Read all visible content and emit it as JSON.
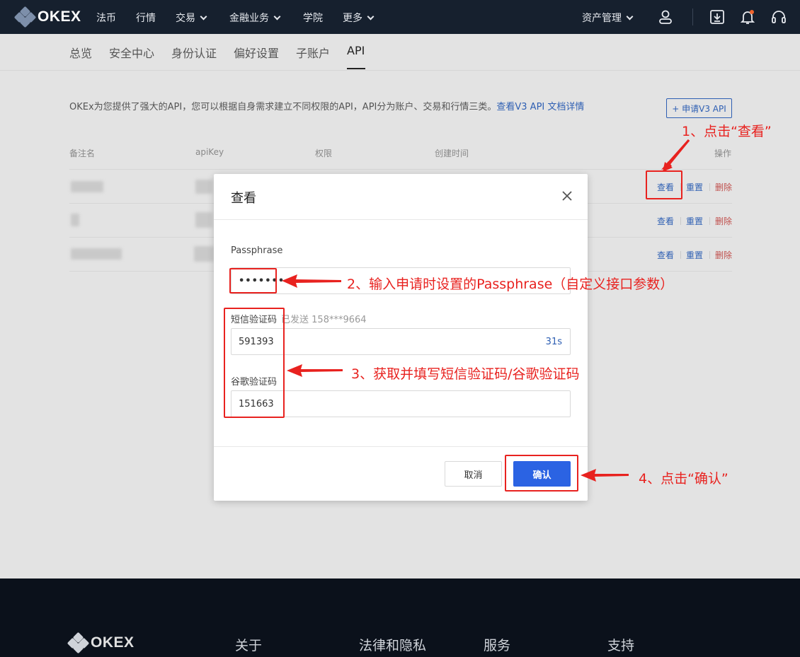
{
  "nav": {
    "logo_text": "OKEX",
    "items": [
      "法币",
      "行情",
      "交易",
      "金融业务",
      "学院",
      "更多"
    ],
    "asset_mgmt": "资产管理"
  },
  "tabs": [
    "总览",
    "安全中心",
    "身份认证",
    "偏好设置",
    "子账户",
    "API"
  ],
  "main": {
    "intro": "OKEx为您提供了强大的API，您可以根据自身需求建立不同权限的API，API分为账户、交易和行情三类。",
    "intro_link": "查看V3 API 文档详情",
    "apply_button": "+ 申请V3 API",
    "table_headers": [
      "备注名",
      "apiKey",
      "权限",
      "创建时间",
      "操作"
    ],
    "row_actions": {
      "view": "查看",
      "reset": "重置",
      "delete": "删除"
    }
  },
  "modal": {
    "title": "查看",
    "passphrase_label": "Passphrase",
    "passphrase_value": "•••••••",
    "sms_label": "短信验证码",
    "sms_hint": "已发送 158***9664",
    "sms_value": "591393",
    "countdown": "31s",
    "google_label": "谷歌验证码",
    "google_value": "151663",
    "cancel": "取消",
    "confirm": "确认"
  },
  "annotations": {
    "step1": "1、点击“查看”",
    "step2": "2、输入申请时设置的Passphrase（自定义接口参数）",
    "step3": "3、获取并填写短信验证码/谷歌验证码",
    "step4": "4、点击“确认”"
  },
  "footer": {
    "logo_text": "OKEX",
    "columns": [
      "关于",
      "法律和隐私",
      "服务",
      "支持"
    ]
  },
  "colors": {
    "accent": "#2b63e3",
    "annotation": "#e8221f",
    "nav_bg": "#16202e"
  }
}
